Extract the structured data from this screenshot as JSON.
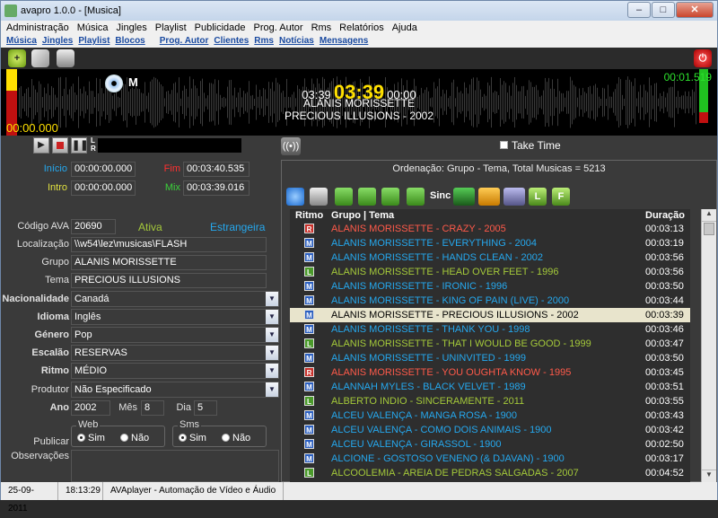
{
  "window": {
    "title": "avapro 1.0.0 - [Musica]",
    "min": "–",
    "max": "□",
    "close": "✕"
  },
  "menu": [
    "Administração",
    "Música",
    "Jingles",
    "Playlist",
    "Publicidade",
    "Prog. Autor",
    "Rms",
    "Relatórios",
    "Ajuda"
  ],
  "links": [
    "Música",
    "Jingles",
    "Playlist",
    "Blocos",
    "Prog. Autor",
    "Clientes",
    "Rms",
    "Notícias",
    "Mensagens"
  ],
  "display": {
    "elapsed": "03:39",
    "current": "03:39",
    "remain": "00:00",
    "artist": "ALANIS MORISSETTE",
    "song": "PRECIOUS ILLUSIONS - 2002",
    "left_time": "00:00.000",
    "right_time": "00:01.519",
    "mode_badge": "M"
  },
  "player": {
    "take_time": "Take Time",
    "meter_l": "L",
    "meter_r": "R"
  },
  "form": {
    "inicio_label": "Início",
    "inicio": "00:00:00.000",
    "fim_label": "Fim",
    "fim": "00:03:40.535",
    "intro_label": "Intro",
    "intro": "00:00:00.000",
    "mix_label": "Mix",
    "mix": "00:03:39.016",
    "codigo_label": "Código AVA",
    "codigo": "20690",
    "ativa": "Ativa",
    "estrangeira": "Estrangeira",
    "localizacao_label": "Localização",
    "localizacao": "\\\\w54\\lez\\musicas\\FLASH",
    "grupo_label": "Grupo",
    "grupo": "ALANIS MORISSETTE",
    "tema_label": "Tema",
    "tema": "PRECIOUS ILLUSIONS",
    "nacionalidade_label": "Nacionalidade",
    "nacionalidade": "Canadá",
    "idioma_label": "Idioma",
    "idioma": "Inglês",
    "genero_label": "Género",
    "genero": "Pop",
    "escalao_label": "Escalão",
    "escalao": "RESERVAS",
    "ritmo_label": "Ritmo",
    "ritmo": "MÉDIO",
    "produtor_label": "Produtor",
    "produtor": "Não Especificado",
    "ano_label": "Ano",
    "ano": "2002",
    "mes_label": "Mês",
    "mes": "8",
    "dia_label": "Dia",
    "dia": "5",
    "web_label": "Web",
    "sms_label": "Sms",
    "sim": "Sim",
    "nao": "Não",
    "publicar_label": "Publicar",
    "observacoes_label": "Observações"
  },
  "list": {
    "ordering": "Ordenação: Grupo - Tema, Total Musicas =  5213",
    "sinc": "Sinc",
    "col_ritmo": "Ritmo",
    "col_grupo": "Grupo | Tema",
    "col_duracao": "Duração",
    "rows": [
      {
        "r": "R",
        "t": "ALANIS MORISSETTE  -  CRAZY - 2005",
        "d": "00:03:13",
        "c": "#ff5a4a"
      },
      {
        "r": "M",
        "t": "ALANIS MORISSETTE  -  EVERYTHING - 2004",
        "d": "00:03:19",
        "c": "#25a8ee"
      },
      {
        "r": "M",
        "t": "ALANIS MORISSETTE  -  HANDS CLEAN - 2002",
        "d": "00:03:56",
        "c": "#25a8ee"
      },
      {
        "r": "L",
        "t": "ALANIS MORISSETTE  -  HEAD OVER FEET - 1996",
        "d": "00:03:56",
        "c": "#a4c93a"
      },
      {
        "r": "M",
        "t": "ALANIS MORISSETTE  -  IRONIC - 1996",
        "d": "00:03:50",
        "c": "#25a8ee"
      },
      {
        "r": "M",
        "t": "ALANIS MORISSETTE  -  KING OF PAIN (LIVE) - 2000",
        "d": "00:03:44",
        "c": "#25a8ee"
      },
      {
        "r": "M",
        "t": "ALANIS MORISSETTE  -  PRECIOUS ILLUSIONS - 2002",
        "d": "00:03:39",
        "c": "#000000",
        "sel": true
      },
      {
        "r": "M",
        "t": "ALANIS MORISSETTE  -  THANK YOU - 1998",
        "d": "00:03:46",
        "c": "#25a8ee"
      },
      {
        "r": "L",
        "t": "ALANIS MORISSETTE  -  THAT I WOULD BE GOOD - 1999",
        "d": "00:03:47",
        "c": "#a4c93a"
      },
      {
        "r": "M",
        "t": "ALANIS MORISSETTE  -  UNINVITED - 1999",
        "d": "00:03:50",
        "c": "#25a8ee"
      },
      {
        "r": "R",
        "t": "ALANIS MORISSETTE  -  YOU OUGHTA KNOW - 1995",
        "d": "00:03:45",
        "c": "#ff5a4a"
      },
      {
        "r": "M",
        "t": "ALANNAH MYLES  -  BLACK VELVET - 1989",
        "d": "00:03:51",
        "c": "#25a8ee"
      },
      {
        "r": "L",
        "t": "ALBERTO INDIO  -  SINCERAMENTE - 2011",
        "d": "00:03:55",
        "c": "#a4c93a"
      },
      {
        "r": "M",
        "t": "ALCEU VALENÇA  -  MANGA ROSA - 1900",
        "d": "00:03:43",
        "c": "#25a8ee"
      },
      {
        "r": "M",
        "t": "ALCEU VALENÇA  -  COMO DOIS ANIMAIS - 1900",
        "d": "00:03:42",
        "c": "#25a8ee"
      },
      {
        "r": "M",
        "t": "ALCEU VALENÇA  -  GIRASSOL - 1900",
        "d": "00:02:50",
        "c": "#25a8ee"
      },
      {
        "r": "M",
        "t": "ALCIONE  -  GOSTOSO VENENO (& DJAVAN) - 1900",
        "d": "00:03:17",
        "c": "#25a8ee"
      },
      {
        "r": "L",
        "t": "ALCOOLEMIA  -  AREIA DE PEDRAS SALGADAS - 2007",
        "d": "00:04:52",
        "c": "#a4c93a"
      }
    ]
  },
  "status": {
    "date": "25-09-2011",
    "time": "18:13:29",
    "app": "AVAplayer - Automação de Vídeo e Áudio"
  }
}
